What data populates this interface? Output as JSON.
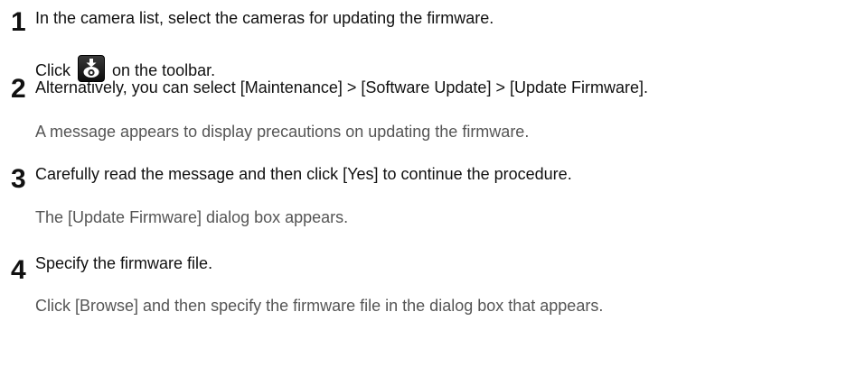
{
  "steps": [
    {
      "number": "1",
      "instruction": "In the camera list, select the cameras for updating the firmware."
    },
    {
      "number": "2",
      "instruction_before": "Click",
      "instruction_after": "on the toolbar.",
      "icon": "update-firmware-icon",
      "alternative": "Alternatively, you can select [Maintenance] > [Software Update] > [Update Firmware].",
      "result": "A message appears to display precautions on updating the firmware."
    },
    {
      "number": "3",
      "instruction": "Carefully read the message and then click [Yes] to continue the procedure.",
      "result": "The [Update Firmware] dialog box appears."
    },
    {
      "number": "4",
      "instruction": "Specify the firmware file.",
      "result": "Click [Browse] and then specify the firmware file in the dialog box that appears."
    }
  ],
  "colors": {
    "text": "#111111",
    "note_text": "#555555",
    "icon_background": "#1a1a1a",
    "icon_arrow": "#ffffff",
    "icon_camera": "#ffffff"
  }
}
